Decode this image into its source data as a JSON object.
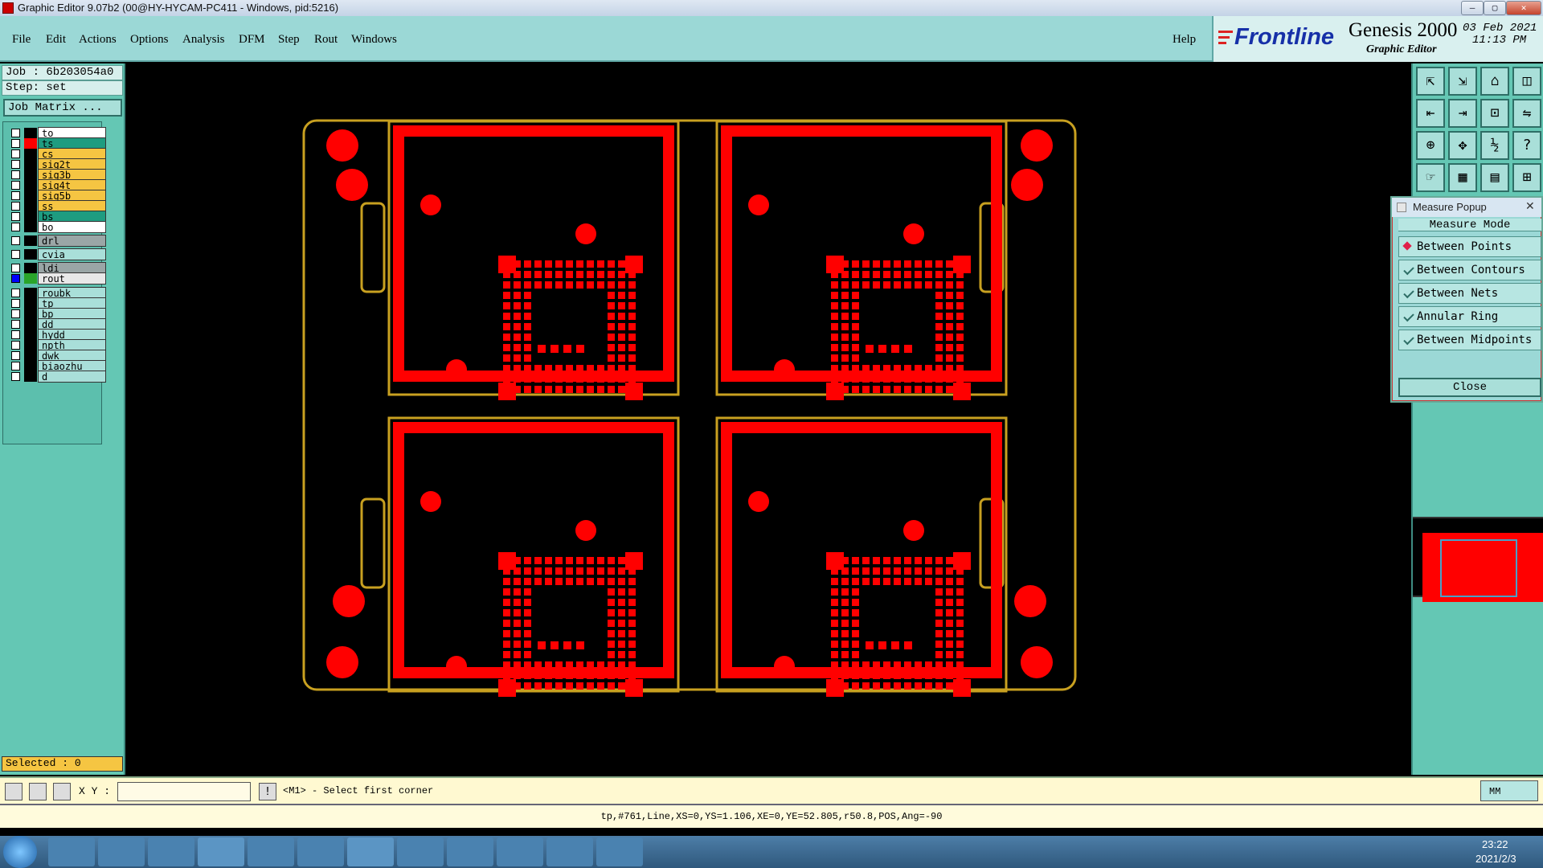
{
  "window": {
    "title": "Graphic Editor 9.07b2 (00@HY-HYCAM-PC411 - Windows, pid:5216)",
    "minimize": "—",
    "maximize": "▢",
    "close": "✕"
  },
  "menu": {
    "items": [
      "File",
      "Edit",
      "Actions",
      "Options",
      "Analysis",
      "DFM",
      "Step",
      "Rout",
      "Windows"
    ],
    "help": "Help"
  },
  "brand": {
    "logo": "Frontline",
    "product": "Genesis 2000",
    "subtitle": "Graphic Editor",
    "date": "03 Feb 2021",
    "time": "11:13 PM"
  },
  "job": {
    "job_label": "Job  :  6b203054a0",
    "step_label": "Step: set",
    "matrix_button": "Job Matrix ..."
  },
  "layers": [
    {
      "name": "to",
      "bg": "#ffffff",
      "swatch": "#000000",
      "checked": false
    },
    {
      "name": "ts",
      "bg": "#1e9c80",
      "swatch": "#ff0000",
      "checked": false
    },
    {
      "name": "cs",
      "bg": "#f5c542",
      "swatch": "#000000",
      "checked": false
    },
    {
      "name": "sig2t",
      "bg": "#f5c542",
      "swatch": "#000000",
      "checked": false
    },
    {
      "name": "sig3b",
      "bg": "#f5c542",
      "swatch": "#000000",
      "checked": false
    },
    {
      "name": "sig4t",
      "bg": "#f5c542",
      "swatch": "#000000",
      "checked": false
    },
    {
      "name": "sig5b",
      "bg": "#f5c542",
      "swatch": "#000000",
      "checked": false
    },
    {
      "name": "ss",
      "bg": "#f5c542",
      "swatch": "#000000",
      "checked": false
    },
    {
      "name": "bs",
      "bg": "#1e9c80",
      "swatch": "#000000",
      "checked": false
    },
    {
      "name": "bo",
      "bg": "#ffffff",
      "swatch": "#000000",
      "checked": false
    },
    {
      "name": "drl",
      "bg": "#9aa6a6",
      "swatch": "#000000",
      "checked": false
    },
    {
      "name": "cvia",
      "bg": "#a9dfd9",
      "swatch": "#000000",
      "checked": false
    },
    {
      "name": "ldi",
      "bg": "#9aa6a6",
      "swatch": "#000000",
      "checked": false
    },
    {
      "name": "rout",
      "bg": "#e8e8e8",
      "swatch": "#2aa52a",
      "checked": true
    },
    {
      "name": "roubk",
      "bg": "#a9dfd9",
      "swatch": "#000000",
      "checked": false
    },
    {
      "name": "tp",
      "bg": "#a9dfd9",
      "swatch": "#000000",
      "checked": false
    },
    {
      "name": "bp",
      "bg": "#a9dfd9",
      "swatch": "#000000",
      "checked": false
    },
    {
      "name": "dd",
      "bg": "#a9dfd9",
      "swatch": "#000000",
      "checked": false
    },
    {
      "name": "hydd",
      "bg": "#a9dfd9",
      "swatch": "#000000",
      "checked": false
    },
    {
      "name": "npth",
      "bg": "#a9dfd9",
      "swatch": "#000000",
      "checked": false
    },
    {
      "name": "dwk",
      "bg": "#a9dfd9",
      "swatch": "#000000",
      "checked": false
    },
    {
      "name": "biaozhu",
      "bg": "#a9dfd9",
      "swatch": "#000000",
      "checked": false
    },
    {
      "name": "d",
      "bg": "#a9dfd9",
      "swatch": "#000000",
      "checked": false
    }
  ],
  "selected": "Selected : 0",
  "measure_popup": {
    "title": "Measure Popup",
    "header": "Measure Mode",
    "options": [
      {
        "label": "Between Points",
        "active": true
      },
      {
        "label": "Between Contours",
        "active": false
      },
      {
        "label": "Between Nets",
        "active": false
      },
      {
        "label": "Annular Ring",
        "active": false
      },
      {
        "label": "Between Midpoints",
        "active": false
      }
    ],
    "close_label": "Close"
  },
  "toolbar_icons": [
    "zoom-fit-icon",
    "zoom-home-icon",
    "home-icon",
    "split-view-icon",
    "pan-left-icon",
    "pan-right-icon",
    "snap-icon",
    "mirror-icon",
    "zoom-area-icon",
    "center-icon",
    "scale-icon",
    "help-icon",
    "hand-icon",
    "grid-icon",
    "layers-icon",
    "measure-icon"
  ],
  "command": {
    "xy_label": "X Y :",
    "xy_value": "",
    "prompt": "<M1> - Select first corner",
    "units": "MM"
  },
  "status": {
    "text": "tp,#761,Line,XS=0,YS=1.106,XE=0,YE=52.805,r50.8,POS,Ang=-90"
  },
  "taskbar": {
    "time": "23:22",
    "date": "2021/2/3"
  },
  "colors": {
    "copper": "#ff0000",
    "outline": "#c8a020",
    "panel": "#64c7b4"
  }
}
